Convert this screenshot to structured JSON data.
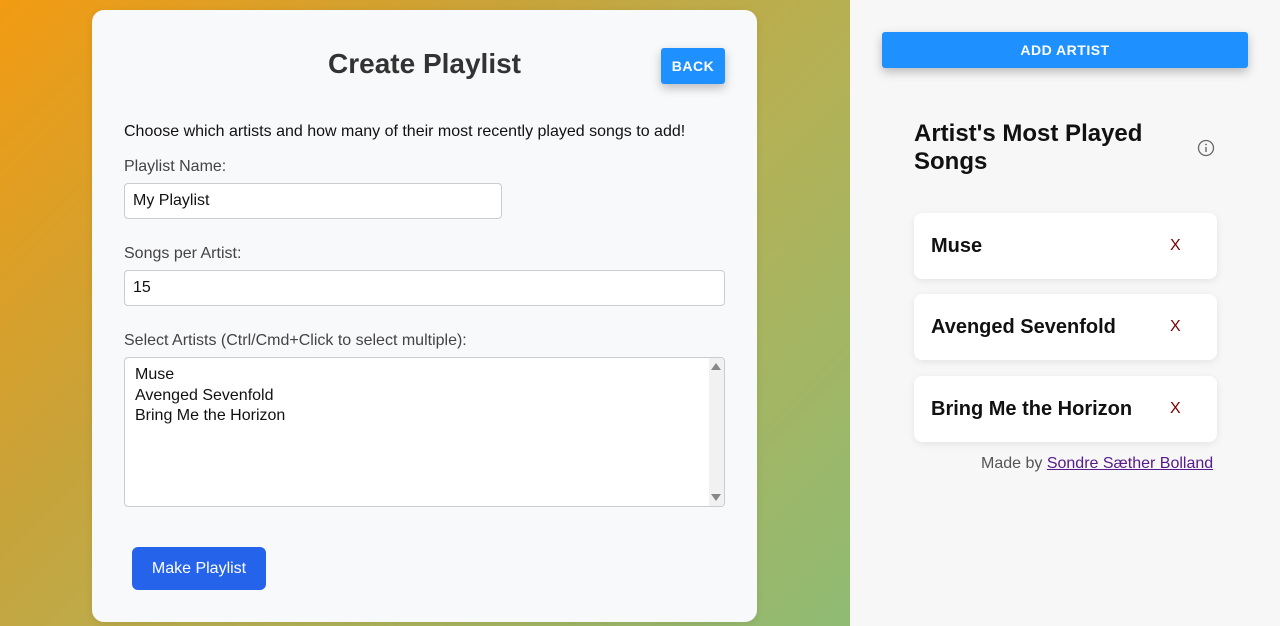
{
  "create": {
    "title": "Create Playlist",
    "back_label": "BACK",
    "intro": "Choose which artists and how many of their most recently played songs to add!",
    "playlist_name_label": "Playlist Name:",
    "playlist_name_value": "My Playlist",
    "songs_per_artist_label": "Songs per Artist:",
    "songs_per_artist_value": "15",
    "select_artists_label": "Select Artists (Ctrl/Cmd+Click to select multiple):",
    "artist_options": [
      "Muse",
      "Avenged Sevenfold",
      "Bring Me the Horizon"
    ],
    "make_playlist_label": "Make Playlist"
  },
  "sidebar": {
    "add_artist_label": "ADD ARTIST",
    "title": "Artist's Most Played Songs",
    "info_icon": "info-icon",
    "artists": [
      {
        "name": "Muse",
        "remove_label": "X"
      },
      {
        "name": "Avenged Sevenfold",
        "remove_label": "X"
      },
      {
        "name": "Bring Me the Horizon",
        "remove_label": "X"
      }
    ],
    "footer_prefix": "Made by",
    "footer_link": "Sondre Sæther Bolland"
  },
  "colors": {
    "accent_blue": "#1e90ff",
    "primary_button": "#2563eb",
    "remove_x": "#7a0000",
    "link_visited": "#551a8b"
  }
}
